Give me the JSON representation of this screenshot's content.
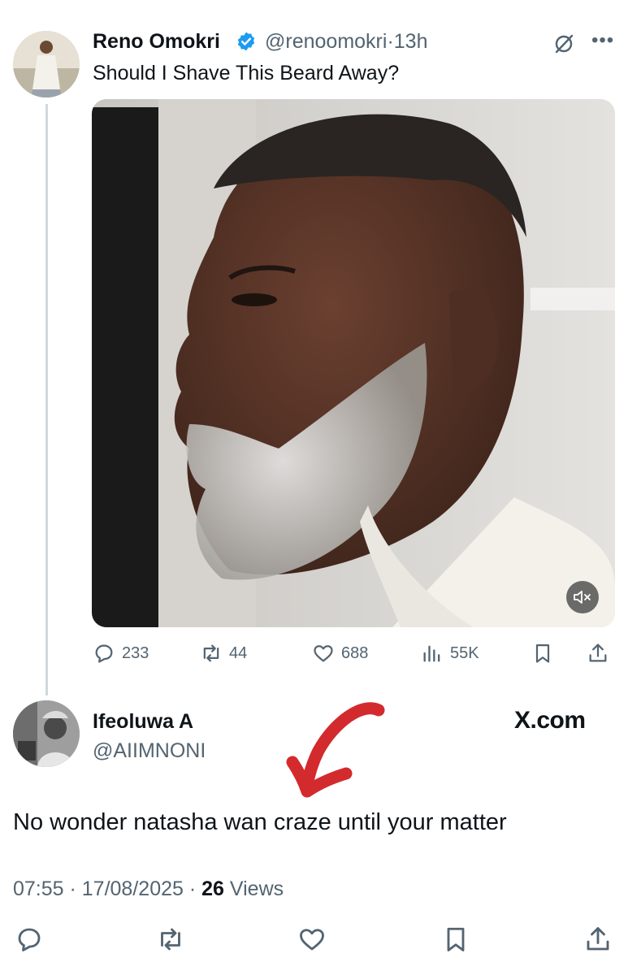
{
  "tweet": {
    "author_name": "Reno Omokri",
    "handle": "@renoomokri",
    "separator": "·",
    "time": "13h",
    "text": "Should I Shave This Beard Away?",
    "media_alt": "Man with grey beard in profile",
    "stats": {
      "replies": "233",
      "reposts": "44",
      "likes": "688",
      "views": "55K"
    }
  },
  "reply": {
    "author_name": "Ifeoluwa A",
    "handle": "@AIIMNONI",
    "text": "No wonder natasha wan craze until your matter",
    "timestamp": "07:55 · 17/08/2025 ·",
    "views_count": "26",
    "views_label": "Views"
  },
  "watermark": "X.com",
  "colors": {
    "verified": "#1d9bf0",
    "secondary_text": "#536471",
    "arrow": "#d32a2e"
  }
}
